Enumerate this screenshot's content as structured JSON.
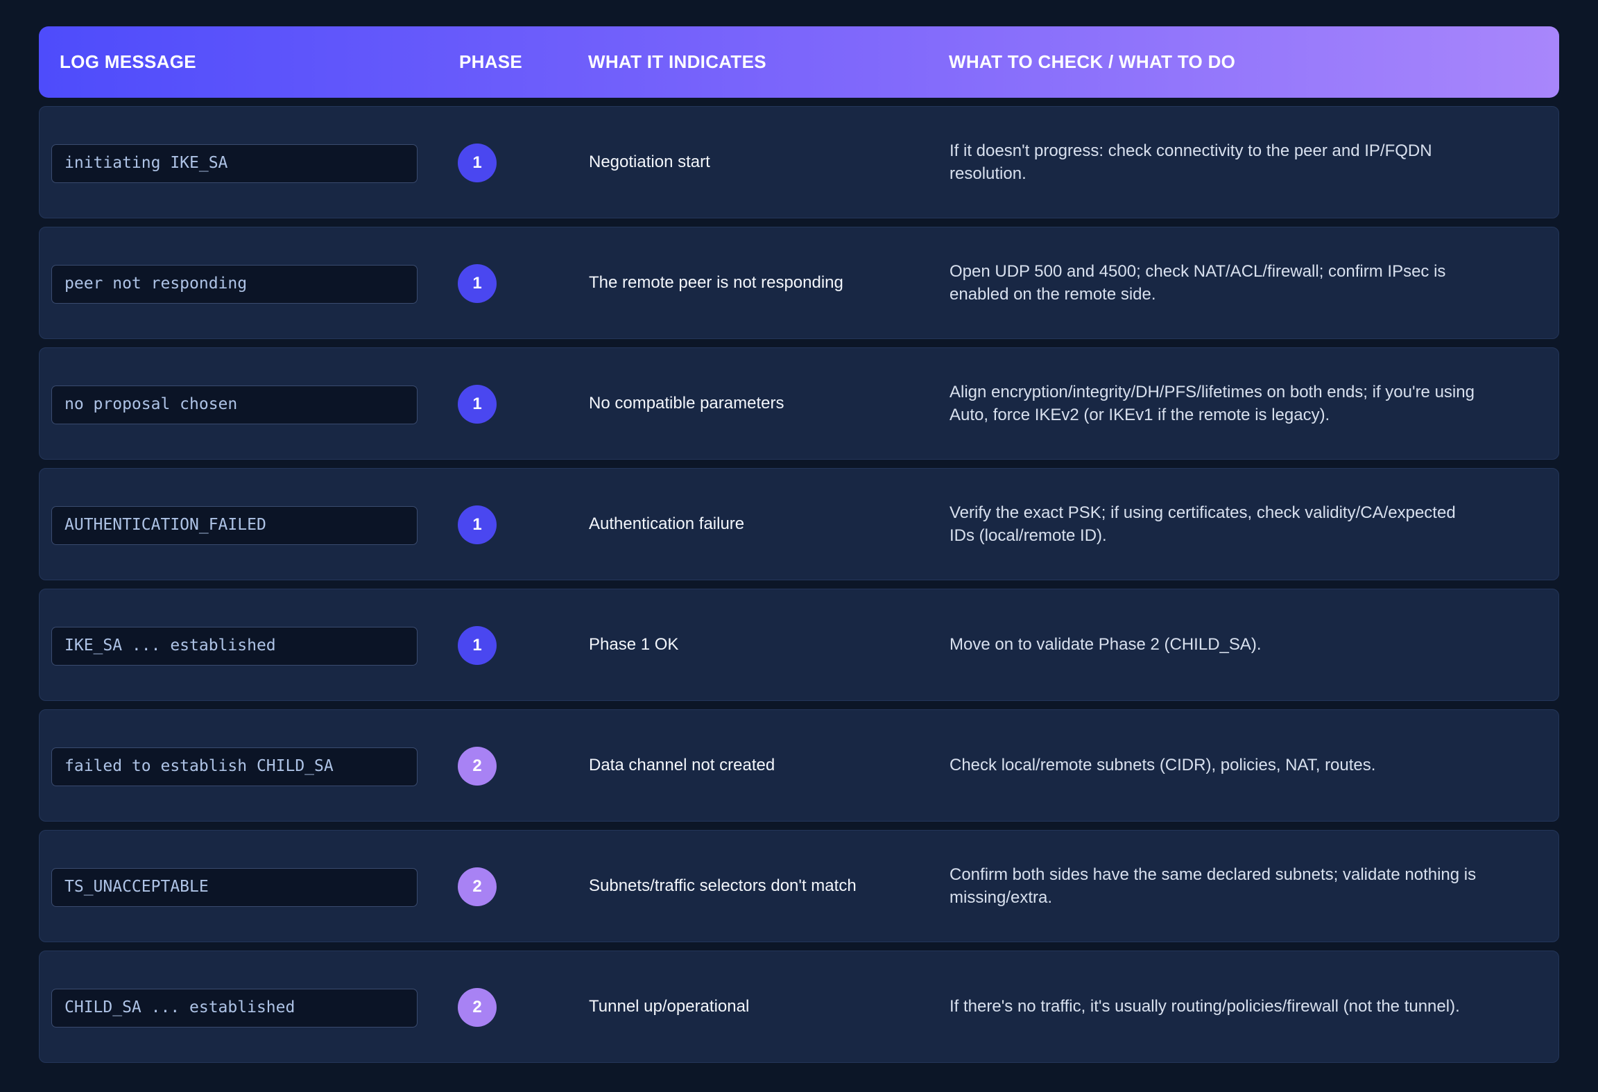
{
  "header": {
    "log_message": "LOG MESSAGE",
    "phase": "PHASE",
    "what_it_indicates": "WHAT IT INDICATES",
    "what_to_do": "WHAT TO CHECK / WHAT TO DO"
  },
  "colors": {
    "page_background": "#0c1627",
    "row_background": "#182744",
    "header_gradient_start": "#4e4cfb",
    "header_gradient_end": "#a886fb",
    "phase_1_badge": "#4a47f0",
    "phase_2_badge": "#a882f4",
    "code_text": "#aec3e6"
  },
  "rows": [
    {
      "log": "initiating IKE_SA",
      "phase": "1",
      "indicates": "Negotiation start",
      "todo": "If it doesn't progress: check connectivity to the peer and IP/FQDN resolution."
    },
    {
      "log": "peer not responding",
      "phase": "1",
      "indicates": "The remote peer is not responding",
      "todo": "Open UDP 500 and 4500; check NAT/ACL/firewall; confirm IPsec is enabled on the remote side."
    },
    {
      "log": "no proposal chosen",
      "phase": "1",
      "indicates": "No compatible parameters",
      "todo": "Align encryption/integrity/DH/PFS/lifetimes on both ends; if you're using Auto, force IKEv2 (or IKEv1 if the remote is legacy)."
    },
    {
      "log": "AUTHENTICATION_FAILED",
      "phase": "1",
      "indicates": "Authentication failure",
      "todo": "Verify the exact PSK; if using certificates, check validity/CA/expected IDs (local/remote ID)."
    },
    {
      "log": "IKE_SA ... established",
      "phase": "1",
      "indicates": "Phase 1 OK",
      "todo": "Move on to validate Phase 2 (CHILD_SA)."
    },
    {
      "log": "failed to establish CHILD_SA",
      "phase": "2",
      "indicates": "Data channel not created",
      "todo": "Check local/remote subnets (CIDR), policies, NAT, routes."
    },
    {
      "log": "TS_UNACCEPTABLE",
      "phase": "2",
      "indicates": "Subnets/traffic selectors don't match",
      "todo": "Confirm both sides have the same declared subnets; validate nothing is missing/extra."
    },
    {
      "log": "CHILD_SA ... established",
      "phase": "2",
      "indicates": "Tunnel up/operational",
      "todo": "If there's no traffic, it's usually routing/policies/firewall (not the tunnel)."
    }
  ]
}
